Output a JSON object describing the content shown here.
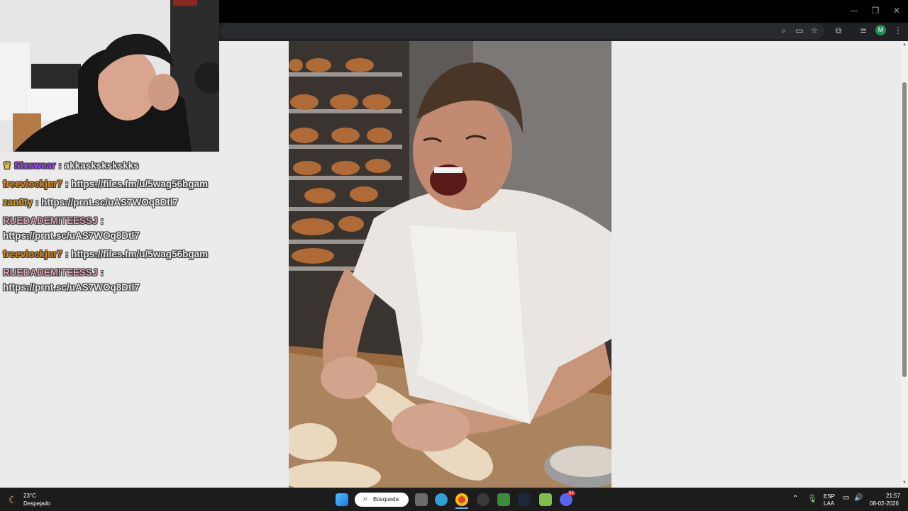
{
  "window": {
    "minimize": "—",
    "restore": "❐",
    "close": "✕"
  },
  "toolbar": {
    "profile_initial": "M"
  },
  "chat": [
    {
      "user": "Sixswear",
      "text": ": akkaskskskskks",
      "color": "#9d4df0",
      "badge": true
    },
    {
      "user": "freeviockjnr7",
      "text": ": https://files.fm/u/5wag56bgam",
      "color": "#d98a1a",
      "badge": false
    },
    {
      "user": "zan0ty",
      "text": ": https://prnt.sc/uAS7WOq8Dtl7",
      "color": "#d8a21c",
      "badge": false
    },
    {
      "user": "RUEDADEMITEESSJ",
      "text": ":",
      "color": "#d9a0b0",
      "badge": false,
      "wrap": "https://prnt.sc/uAS7WOq8Dtl7"
    },
    {
      "user": "freeviockjnr7",
      "text": ": https://files.fm/u/5wag56bgam",
      "color": "#d98a1a",
      "badge": false
    },
    {
      "user": "RUEDADEMITEESSJ",
      "text": ":",
      "color": "#d9a0b0",
      "badge": false,
      "wrap": "https://prnt.sc/uAS7WOq8Dtl7"
    }
  ],
  "taskbar": {
    "weather_temp": "23°C",
    "weather_desc": "Despejado",
    "search_label": "Búsqueda",
    "lang": "ESP",
    "layout": "LAA",
    "time": "21:57",
    "date": "08-02-2026",
    "discord_badge": "51"
  }
}
